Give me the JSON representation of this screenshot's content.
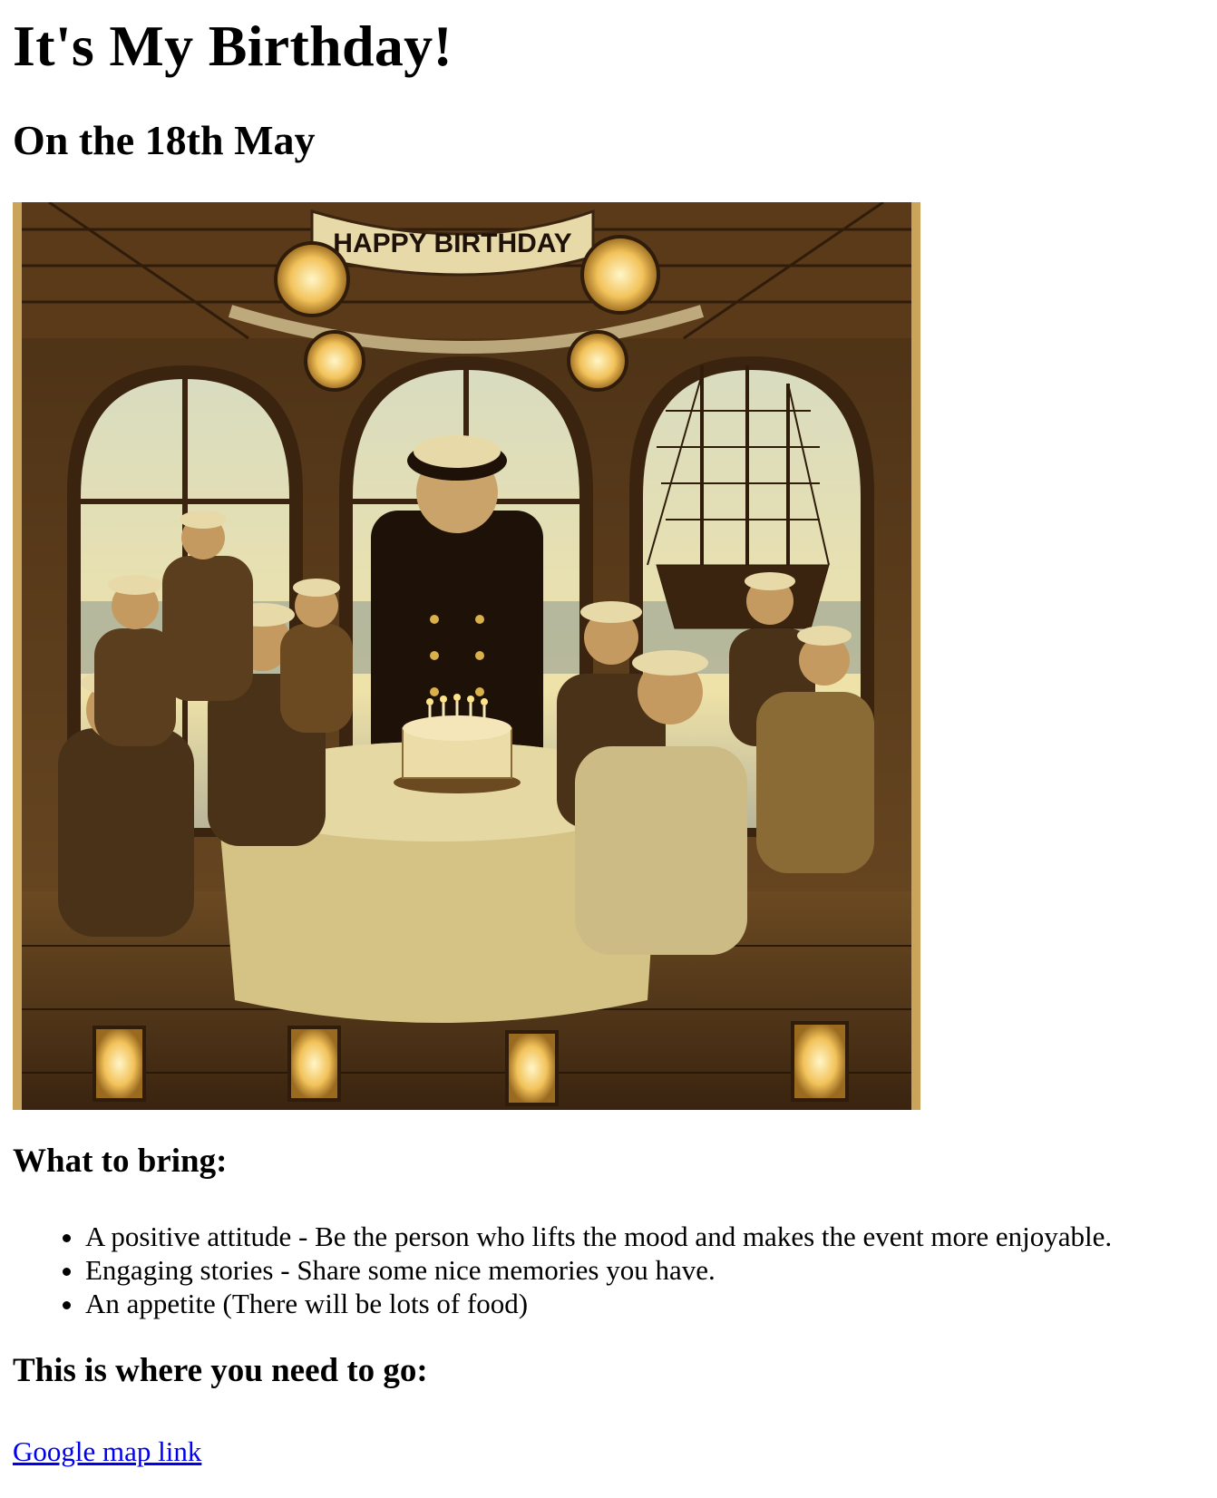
{
  "title": "It's My Birthday!",
  "subtitle": "On the 18th May",
  "hero_image": {
    "banner_text": "HAPPY BIRTHDAY"
  },
  "bring": {
    "heading": "What to bring:",
    "items": [
      "A positive attitude - Be the person who lifts the mood and makes the event more enjoyable.",
      "Engaging stories - Share some nice memories you have.",
      "An appetite (There will be lots of food)"
    ]
  },
  "location": {
    "heading": "This is where you need to go:",
    "link_text": "Google map link"
  },
  "colors": {
    "link": "#0000ee",
    "sepia_dark": "#3a2410",
    "sepia_mid": "#8a6a35",
    "sepia_light": "#e8d9a8"
  }
}
